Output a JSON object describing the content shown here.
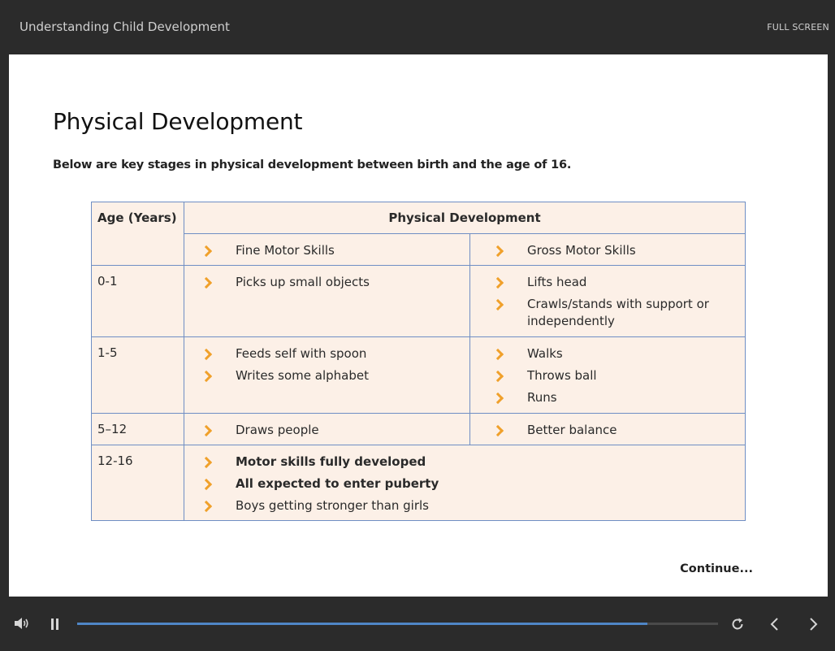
{
  "header": {
    "course_title": "Understanding Child Development",
    "fullscreen_label": "FULL SCREEN"
  },
  "slide": {
    "title": "Physical Development",
    "subtitle": "Below are key stages in physical development between birth and the age of 16.",
    "continue_label": "Continue..."
  },
  "table": {
    "age_header": "Age (Years)",
    "dev_header": "Physical Development",
    "fine_header": "Fine Motor Skills",
    "gross_header": "Gross Motor Skills",
    "rows": [
      {
        "age": "0-1",
        "fine": [
          "Picks up small objects"
        ],
        "gross": [
          "Lifts head",
          "Crawls/stands with support or independently"
        ]
      },
      {
        "age": "1-5",
        "fine": [
          "Feeds self with spoon",
          "Writes some alphabet"
        ],
        "gross": [
          "Walks",
          "Throws ball",
          "Runs"
        ]
      },
      {
        "age": "5–12",
        "fine": [
          "Draws people"
        ],
        "gross": [
          "Better balance"
        ]
      },
      {
        "age": "12-16",
        "combined": [
          "Motor skills fully developed",
          "All expected to enter puberty",
          "Boys getting stronger than girls"
        ]
      }
    ]
  },
  "player": {
    "progress": 0.89,
    "accent_color": "#4f86c6",
    "bullet_color": "#f0a02a",
    "icons": [
      "volume-icon",
      "pause-icon",
      "replay-icon",
      "prev-icon",
      "next-icon"
    ]
  }
}
